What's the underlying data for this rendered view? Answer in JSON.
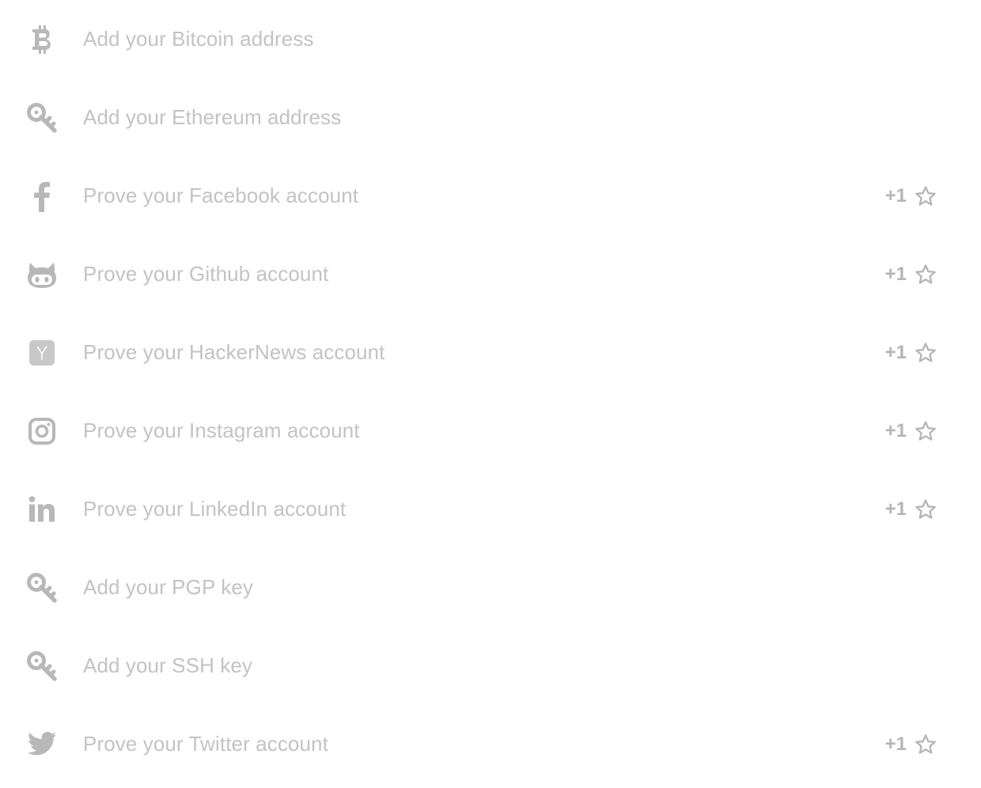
{
  "colors": {
    "icon": "#b8b8b8",
    "label": "#c3c3c3",
    "reward": "#b5b5b5",
    "background": "#ffffff"
  },
  "items": [
    {
      "icon": "bitcoin-icon",
      "label": "Add your Bitcoin address",
      "reward": ""
    },
    {
      "icon": "key-icon",
      "label": "Add your Ethereum address",
      "reward": ""
    },
    {
      "icon": "facebook-icon",
      "label": "Prove your Facebook account",
      "reward": "+1"
    },
    {
      "icon": "github-icon",
      "label": "Prove your Github account",
      "reward": "+1"
    },
    {
      "icon": "hackernews-icon",
      "label": "Prove your HackerNews account",
      "reward": "+1"
    },
    {
      "icon": "instagram-icon",
      "label": "Prove your Instagram account",
      "reward": "+1"
    },
    {
      "icon": "linkedin-icon",
      "label": "Prove your LinkedIn account",
      "reward": "+1"
    },
    {
      "icon": "key-icon",
      "label": "Add your PGP key",
      "reward": ""
    },
    {
      "icon": "key-icon",
      "label": "Add your SSH key",
      "reward": ""
    },
    {
      "icon": "twitter-icon",
      "label": "Prove your Twitter account",
      "reward": "+1"
    }
  ]
}
